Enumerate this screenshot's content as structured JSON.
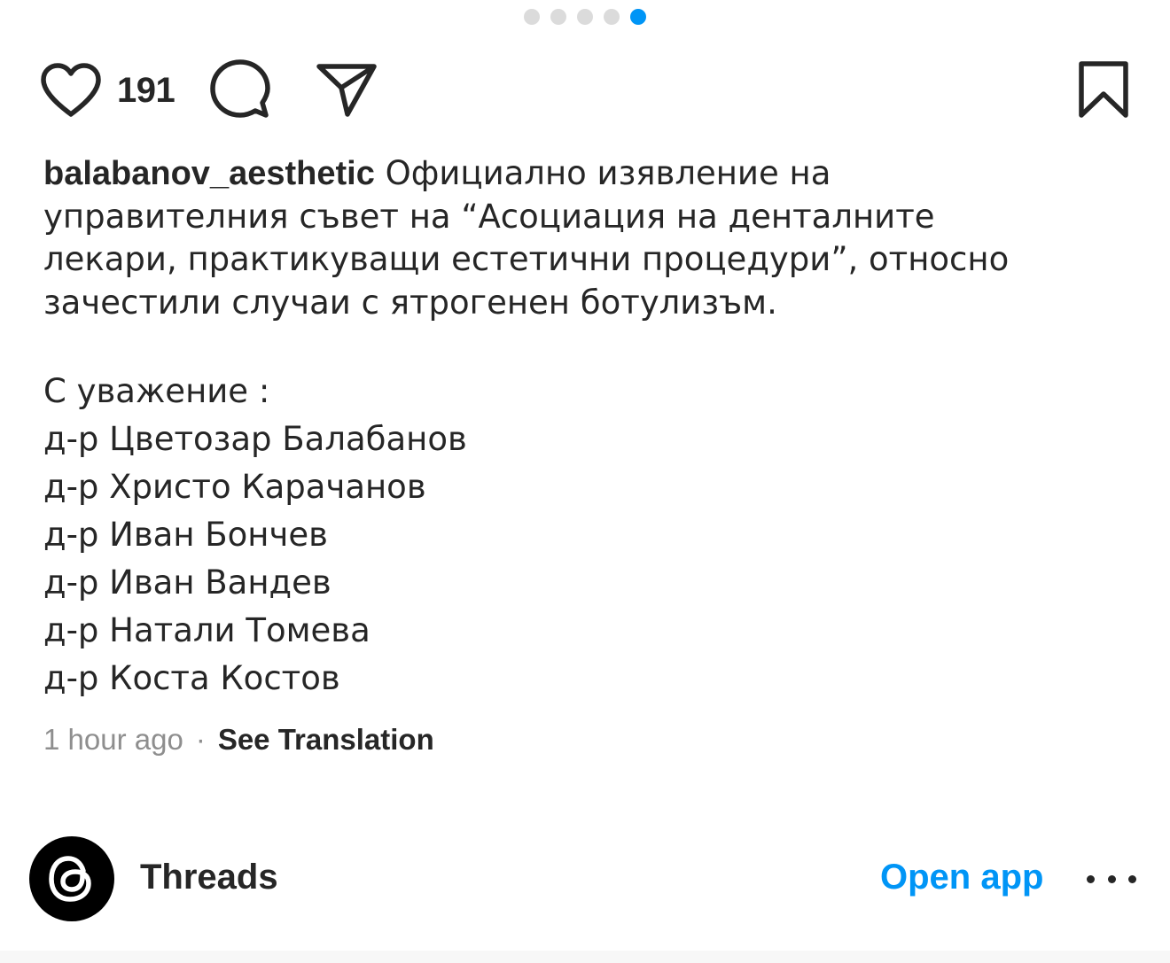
{
  "carousel": {
    "total": 5,
    "active_index": 4
  },
  "actions": {
    "like_count": "191",
    "icons": [
      "heart-icon",
      "comment-icon",
      "share-icon",
      "bookmark-icon"
    ]
  },
  "caption": {
    "username": "balabanov_aesthetic",
    "lines": [
      "Официално изявление на",
      "управителния съвет на “Асоциация на денталните",
      "лекари, практикуващи естетични процедури”, относно",
      "зачестили случаи с ятрогенен ботулизъм."
    ],
    "closing": "С уважение :",
    "signatures": [
      "д-р Цветозар Балабанов",
      "д-р Христо Карачанов",
      "д-р Иван Бончев",
      "д-р Иван Вандев",
      "д-р Натали Томева",
      "д-р Коста Костов"
    ]
  },
  "meta": {
    "time": "1 hour ago",
    "separator": "·",
    "translate_label": "See Translation"
  },
  "banner": {
    "app_name": "Threads",
    "open_label": "Open app"
  },
  "colors": {
    "accent": "#0095f6",
    "text": "#262626",
    "muted": "#8e8e8e"
  }
}
